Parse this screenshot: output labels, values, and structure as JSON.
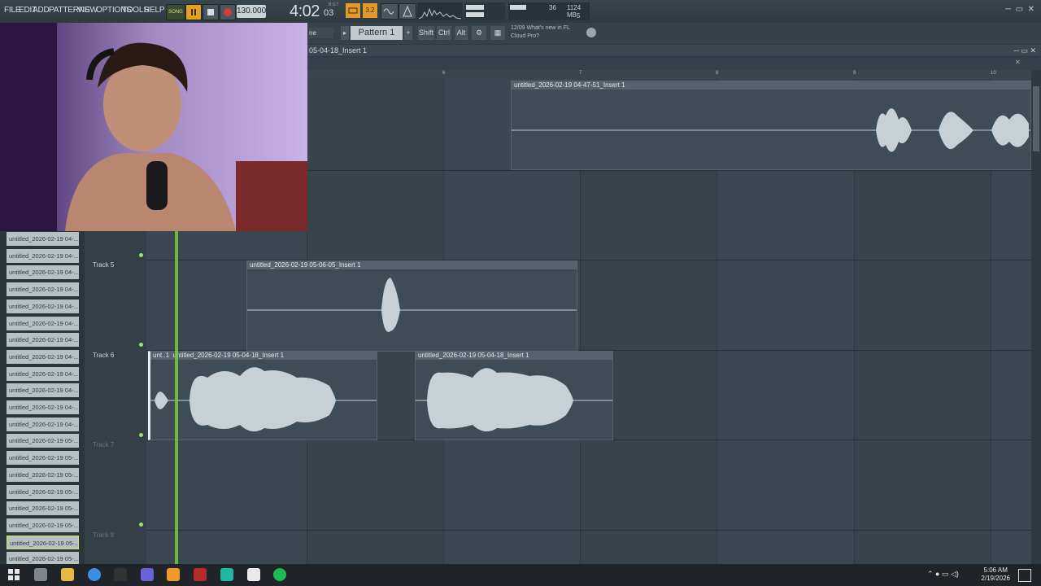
{
  "menu": [
    "FILE",
    "EDIT",
    "ADD",
    "PATTERNS",
    "VIEW",
    "OPTIONS",
    "TOOLS",
    "HELP"
  ],
  "transport": {
    "song_label": "SONG",
    "tempo": "130.000",
    "time_main": "4:02",
    "time_sub": "03",
    "time_mini": "B:S:T",
    "snap_label": "3.2"
  },
  "cpu": {
    "value1": "36",
    "mem": "1124 MB",
    "value2": "5"
  },
  "toolbar2": {
    "pattern": "Pattern 1",
    "shift": "Shift",
    "ctrl": "Ctrl",
    "alt": "Alt",
    "news_line1": "12/09  What's new in FL",
    "news_line2": "Cloud Pro?",
    "mode_partial": "ne"
  },
  "playlist": {
    "title": "05-04-18_Insert 1",
    "ruler": [
      "6",
      "7",
      "8",
      "9",
      "10"
    ],
    "tracks": [
      {
        "name": "Track 5",
        "dim": false
      },
      {
        "name": "Track 6",
        "dim": false
      },
      {
        "name": "Track 7",
        "dim": true
      },
      {
        "name": "Track 8",
        "dim": true
      }
    ],
    "clips": {
      "top": "untitled_2026-02-19 04-47-51_Insert 1",
      "track5": "untitled_2026-02-19 05-06-05_Insert 1",
      "track6_small": "unt..1",
      "track6_a": "untitled_2026-02-19 05-04-18_Insert 1",
      "track6_b": "untitled_2026-02-19 05-04-18_Insert 1"
    }
  },
  "browser_items": [
    "untitled_2026-02-19 04-...",
    "untitled_2026-02-19 04-...",
    "untitled_2026-02-19 04-...",
    "untitled_2026-02-19 04-...",
    "untitled_2026-02-19 04-...",
    "untitled_2026-02-19 04-...",
    "untitled_2026-02-19 04-...",
    "untitled_2026-02-19 04-...",
    "untitled_2026-02-19 04-...",
    "untitled_2026-02-19 04-...",
    "untitled_2026-02-19 04-...",
    "untitled_2026-02-19 04-...",
    "untitled_2026-02-19 05-...",
    "untitled_2026-02-19 05-...",
    "untitled_2026-02-19 05-...",
    "untitled_2026-02-19 05-...",
    "untitled_2026-02-19 05-...",
    "untitled_2026-02-19 05-...",
    "untitled_2026-02-19 05-...",
    "untitled_2026-02-19 05-..."
  ],
  "taskbar": {
    "time": "5:06 AM",
    "date": "2/19/2026"
  },
  "colors": {
    "accent_orange": "#e39a2b",
    "playhead_green": "#7ac93f",
    "grid_bg": "#394851"
  }
}
